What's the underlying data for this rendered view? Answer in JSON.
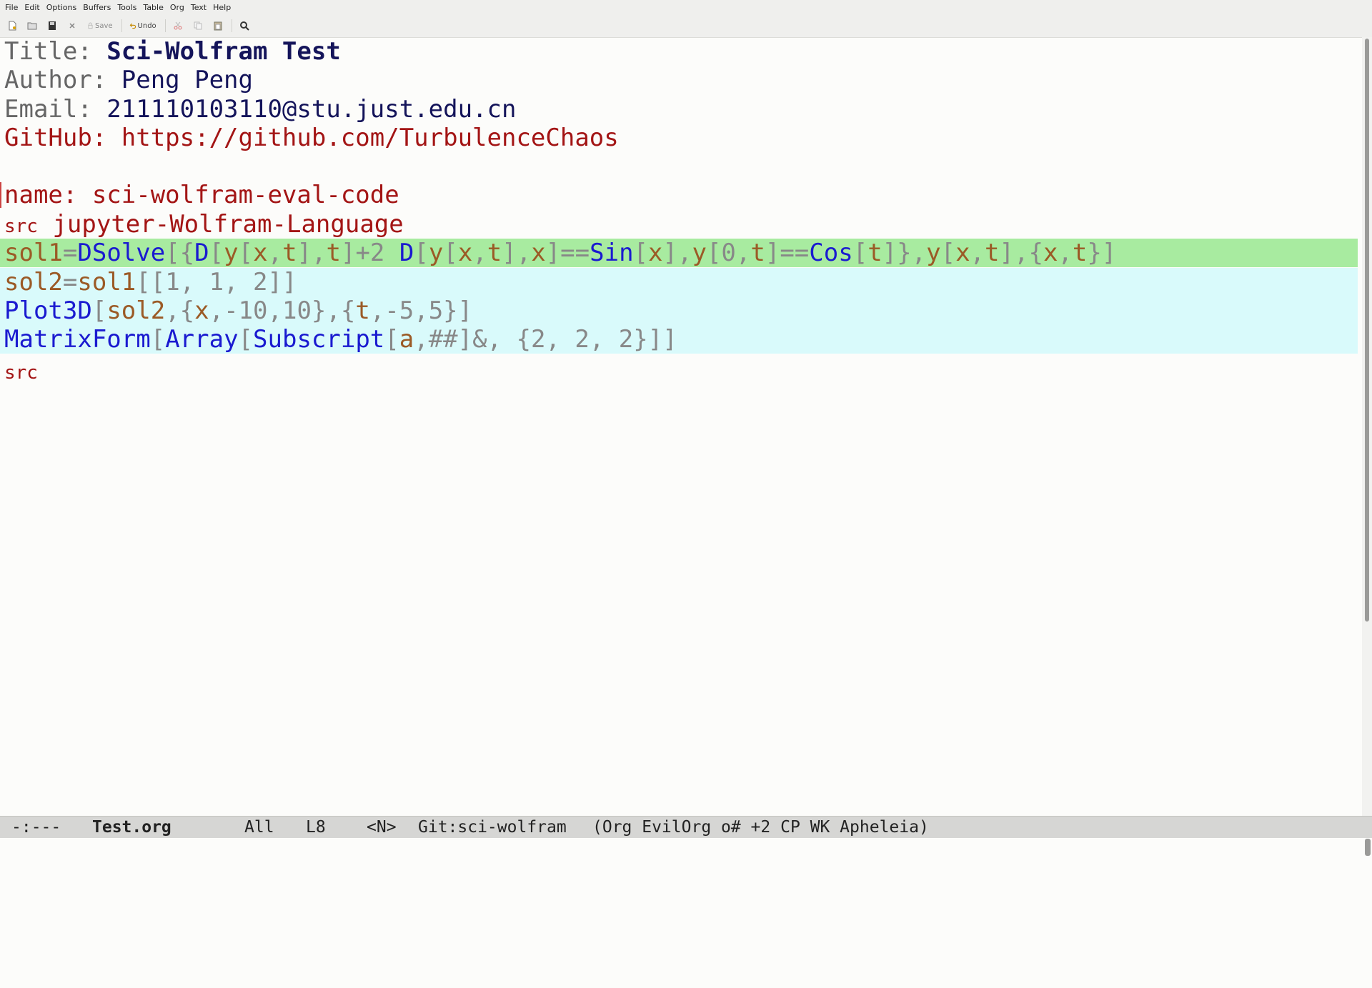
{
  "menubar": {
    "items": [
      "File",
      "Edit",
      "Options",
      "Buffers",
      "Tools",
      "Table",
      "Org",
      "Text",
      "Help"
    ]
  },
  "toolbar": {
    "save_label": "Save",
    "undo_label": "Undo",
    "icons": [
      "new-file-icon",
      "open-folder-icon",
      "save-disk-icon",
      "close-icon",
      "save-icon",
      "undo-icon",
      "cut-icon",
      "copy-icon",
      "paste-icon",
      "search-icon"
    ]
  },
  "editor": {
    "title_key": "Title: ",
    "title_val": "Sci-Wolfram Test",
    "author_key": "Author: ",
    "author_val": "Peng Peng",
    "email_key": "Email: ",
    "email_val": "211110103110@stu.just.edu.cn",
    "github_key": "GitHub: ",
    "github_val": "https://github.com/TurbulenceChaos",
    "name_key": "name: ",
    "name_val": "sci-wolfram-eval-code",
    "src_begin_kw": "src",
    "src_lang": "jupyter-Wolfram-Language",
    "src_end_kw": "src",
    "code": {
      "l1": [
        [
          "var",
          "sol1"
        ],
        [
          "pu",
          "="
        ],
        [
          "fn",
          "DSolve"
        ],
        [
          "pu",
          "[{"
        ],
        [
          "fn",
          "D"
        ],
        [
          "pu",
          "["
        ],
        [
          "var",
          "y"
        ],
        [
          "pu",
          "["
        ],
        [
          "var",
          "x"
        ],
        [
          "pu",
          ","
        ],
        [
          "var",
          "t"
        ],
        [
          "pu",
          "],"
        ],
        [
          "var",
          "t"
        ],
        [
          "pu",
          "]+2 "
        ],
        [
          "fn",
          "D"
        ],
        [
          "pu",
          "["
        ],
        [
          "var",
          "y"
        ],
        [
          "pu",
          "["
        ],
        [
          "var",
          "x"
        ],
        [
          "pu",
          ","
        ],
        [
          "var",
          "t"
        ],
        [
          "pu",
          "],"
        ],
        [
          "var",
          "x"
        ],
        [
          "pu",
          "]=="
        ],
        [
          "fn",
          "Sin"
        ],
        [
          "pu",
          "["
        ],
        [
          "var",
          "x"
        ],
        [
          "pu",
          "],"
        ],
        [
          "var",
          "y"
        ],
        [
          "pu",
          "[0,"
        ],
        [
          "var",
          "t"
        ],
        [
          "pu",
          "]=="
        ],
        [
          "fn",
          "Cos"
        ],
        [
          "pu",
          "["
        ],
        [
          "var",
          "t"
        ],
        [
          "pu",
          "]},"
        ],
        [
          "var",
          "y"
        ],
        [
          "pu",
          "["
        ],
        [
          "var",
          "x"
        ],
        [
          "pu",
          ","
        ],
        [
          "var",
          "t"
        ],
        [
          "pu",
          "],{"
        ],
        [
          "var",
          "x"
        ],
        [
          "pu",
          ","
        ],
        [
          "var",
          "t"
        ],
        [
          "pu",
          "}]"
        ]
      ],
      "l2": [
        [
          "var",
          "sol2"
        ],
        [
          "pu",
          "="
        ],
        [
          "var",
          "sol1"
        ],
        [
          "pu",
          "[[1, 1, 2]]"
        ]
      ],
      "l3": [
        [
          "fn",
          "Plot3D"
        ],
        [
          "pu",
          "["
        ],
        [
          "var",
          "sol2"
        ],
        [
          "pu",
          ",{"
        ],
        [
          "var",
          "x"
        ],
        [
          "pu",
          ",-10,10},{"
        ],
        [
          "var",
          "t"
        ],
        [
          "pu",
          ",-5,5}]"
        ]
      ],
      "l4": [
        [
          "fn",
          "MatrixForm"
        ],
        [
          "pu",
          "["
        ],
        [
          "fn",
          "Array"
        ],
        [
          "pu",
          "["
        ],
        [
          "fn",
          "Subscript"
        ],
        [
          "pu",
          "["
        ],
        [
          "var",
          "a"
        ],
        [
          "pu",
          ",##]&, {2, 2, 2}]]"
        ]
      ]
    }
  },
  "modeline": {
    "status": "-:---",
    "buffer": "Test.org",
    "position": "All",
    "line": "L8",
    "evil_state": "<N>",
    "vc": "Git:sci-wolfram",
    "modes": "(Org EvilOrg o# +2 CP WK Apheleia)"
  },
  "colors": {
    "function": "#1a1ad0",
    "variable": "#9b5a26",
    "punctuation": "#888888",
    "keyword_red": "#a31515",
    "highlight_current_line": "#a8eba0",
    "src_block_background": "#d9fafb"
  }
}
